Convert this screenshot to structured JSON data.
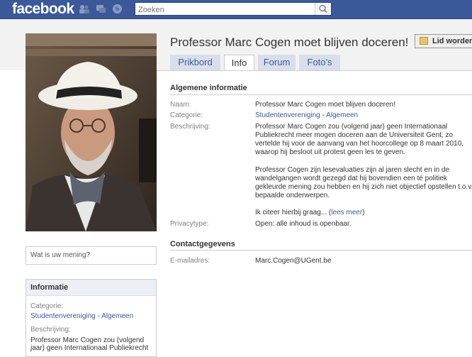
{
  "topbar": {
    "logo": "facebook",
    "search_placeholder": "Zoeken"
  },
  "page": {
    "title": "Professor Marc Cogen moet blijven doceren!",
    "like_label": "Lid worden"
  },
  "tabs": [
    {
      "label": "Prikbord"
    },
    {
      "label": "Info"
    },
    {
      "label": "Forum"
    },
    {
      "label": "Foto's"
    }
  ],
  "info": {
    "general_title": "Algemene informatie",
    "name_label": "Naam:",
    "name_value": "Professor Marc Cogen moet blijven doceren!",
    "category_label": "Categorie:",
    "category_link1": "Studentenvereniging",
    "category_sep": " - ",
    "category_link2": "Algemeen",
    "description_label": "Beschrijving:",
    "description_p1_l1": "Professor Marc Cogen zou (volgend jaar) geen Internationaal",
    "description_p1_l2": "Publiekrecht meer mogen doceren aan de Universiteit Gent, zo",
    "description_p1_l3": "vertelde hij voor de aanvang van het hoorcollege op 8 maart 2010,",
    "description_p1_l4": "waarop hij besloot uit protest geen les te geven.",
    "description_p2_l1": "Professor Cogen zijn lesevaluaties zijn al jaren slecht en in de",
    "description_p2_l2": "wandelgangen wordt gezegd dat hij bovendien een té politiek",
    "description_p2_l3": "gekleurde mening zou hebben en hij zich niet objectief opstellen t.o.v.",
    "description_p2_l4": "bepaalde onderwerpen.",
    "description_p3": "Ik citeer hierbij graag... (",
    "read_more": "lees meer",
    "description_p3_end": ")",
    "privacy_label": "Privacytype:",
    "privacy_value": "Open: alle inhoud is openbaar.",
    "contact_title": "Contactgegevens",
    "email_label": "E-mailadres:",
    "email_value": "Marc.Cogen@UGent.be"
  },
  "sidebar": {
    "comment_placeholder": "Wat is uw mening?",
    "info_title": "Informatie",
    "category_label": "Categorie:",
    "category_link1": "Studentenvereniging",
    "category_sep": " - ",
    "category_link2": "Algemeen",
    "description_label": "Beschrijving:",
    "description_l1": "Professor Marc Cogen zou (volgend",
    "description_l2": "jaar) geen Internationaal Publiekrecht"
  },
  "colors": {
    "brand_blue": "#3b5998",
    "tab_inactive": "#d8dfea",
    "strip": "#f2f2f2"
  },
  "icons": [
    "friends-icon",
    "messages-icon",
    "globe-icon",
    "search-icon",
    "like-page-icon"
  ]
}
